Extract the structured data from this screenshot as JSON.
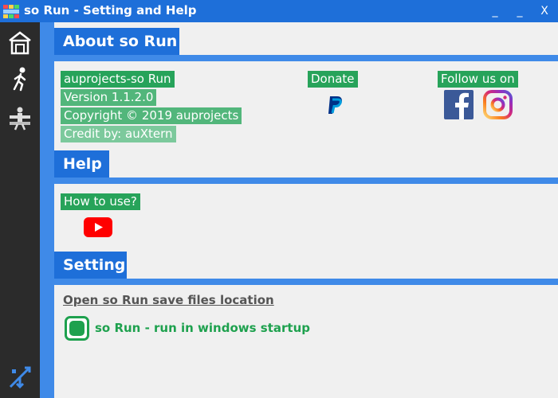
{
  "window": {
    "title": "so Run - Setting and Help",
    "minimize": "_",
    "maximize": "_",
    "close": "X"
  },
  "sidebar": {
    "items": [
      {
        "icon": "home-icon"
      },
      {
        "icon": "runner-icon"
      },
      {
        "icon": "settings-person-icon"
      },
      {
        "icon": "fork-arrow-icon"
      }
    ]
  },
  "about": {
    "heading": "About so Run",
    "app_name": "auprojects-so Run",
    "version": "Version 1.1.2.0",
    "copyright": "Copyright ©  2019 auprojects",
    "credit": "Credit by: auXtern",
    "donate_label": "Donate",
    "donate_icon": "paypal-icon",
    "follow_label": "Follow us on",
    "social": [
      "facebook-icon",
      "instagram-icon"
    ]
  },
  "help": {
    "heading": "Help",
    "how_to": "How to use?",
    "video_icon": "youtube-icon"
  },
  "setting": {
    "heading": "Setting",
    "open_location": "Open so Run save files location",
    "startup_label": "so Run - run in windows startup",
    "startup_enabled": true
  },
  "colors": {
    "titlebar": "#1e6fd9",
    "accent": "#3f8ae8",
    "green": "#27a35a",
    "toggle_green": "#1ea14e"
  }
}
